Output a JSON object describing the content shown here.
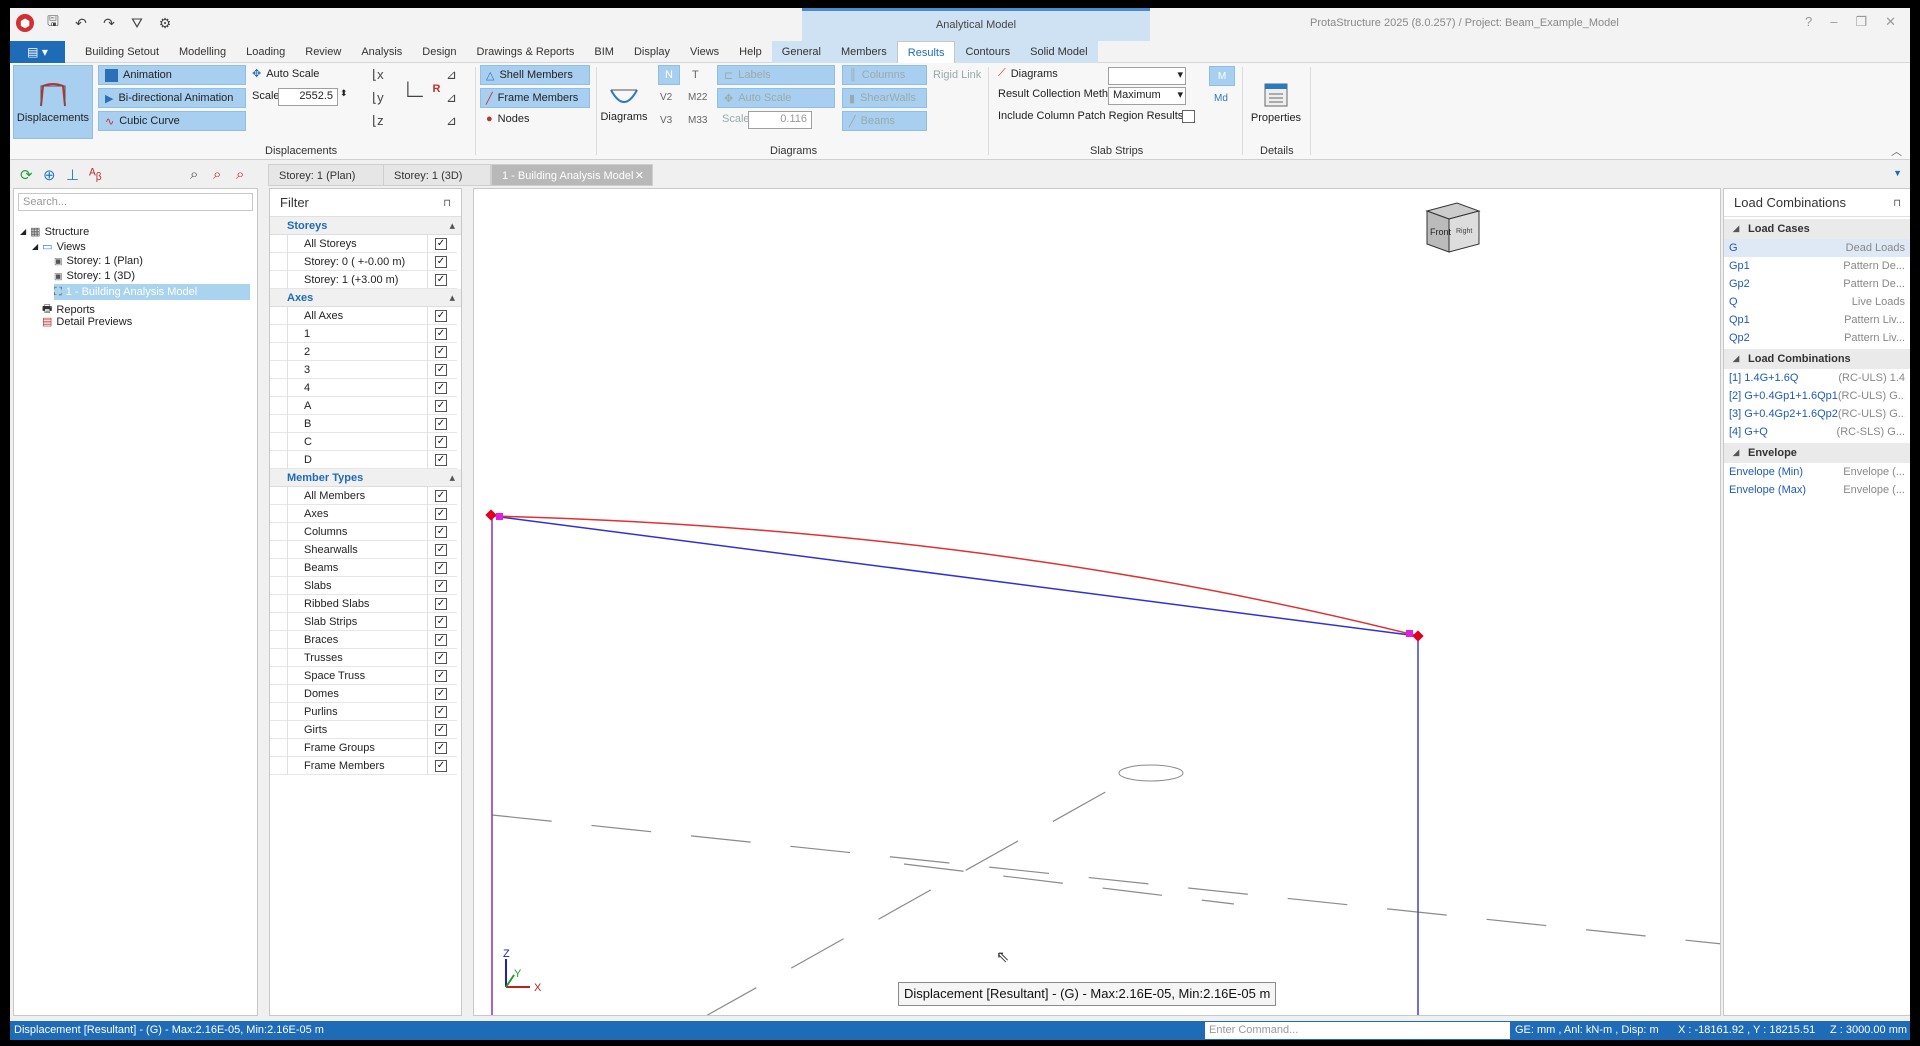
{
  "app": {
    "title": "ProtaStructure 2025 (8.0.257) / Project: Beam_Example_Model",
    "context_header": "Analytical Model"
  },
  "menu": {
    "tabs": [
      "Building Setout",
      "Modelling",
      "Loading",
      "Review",
      "Analysis",
      "Design",
      "Drawings & Reports",
      "BIM",
      "Display",
      "Views",
      "Help"
    ],
    "context_tabs": [
      "General",
      "Members",
      "Results",
      "Contours",
      "Solid Model"
    ],
    "active": "Results"
  },
  "ribbon": {
    "displacements": "Displacements",
    "animation": "Animation",
    "bidir": "Bi-directional Animation",
    "cubic": "Cubic Curve",
    "auto_scale": "Auto Scale",
    "scale_label": "Scale",
    "scale_value": "2552.5",
    "shell_members": "Shell Members",
    "frame_members": "Frame Members",
    "nodes": "Nodes",
    "diagrams": "Diagrams",
    "n": "N",
    "t": "T",
    "v2": "V2",
    "m22": "M22",
    "v3": "V3",
    "m33": "M33",
    "labels": "Labels",
    "auto_scale2": "Auto Scale",
    "scale2_label": "Scale",
    "scale2_value": "0.116",
    "columns": "Columns",
    "shearwalls": "ShearWalls",
    "beams": "Beams",
    "rigid_link": "Rigid Link",
    "ss_diagrams": "Diagrams",
    "rcm_label": "Result Collection Method",
    "rcm_value": "Maximum",
    "include_label": "Include Column Patch Region Results",
    "m": "M",
    "md": "Md",
    "properties": "Properties",
    "groups": {
      "displacements": "Displacements",
      "diagrams": "Diagrams",
      "slab_strips": "Slab Strips",
      "details": "Details"
    }
  },
  "doc_tabs": [
    "Storey: 1 (Plan)",
    "Storey: 1 (3D)",
    "1 - Building Analysis Model"
  ],
  "tree": {
    "search": "Search...",
    "structure": "Structure",
    "views": "Views",
    "v1": "Storey: 1 (Plan)",
    "v2": "Storey: 1 (3D)",
    "v3": "1 - Building Analysis Model",
    "reports": "Reports",
    "previews": "Detail Previews"
  },
  "filter": {
    "title": "Filter",
    "sections": [
      {
        "name": "Storeys",
        "items": [
          "All Storeys",
          "Storey: 0 ( +-0.00 m)",
          "Storey: 1 (+3.00 m)"
        ]
      },
      {
        "name": "Axes",
        "items": [
          "All Axes",
          "1",
          "2",
          "3",
          "4",
          "A",
          "B",
          "C",
          "D"
        ]
      },
      {
        "name": "Member Types",
        "items": [
          "All Members",
          "Axes",
          "Columns",
          "Shearwalls",
          "Beams",
          "Slabs",
          "Ribbed Slabs",
          "Slab Strips",
          "Braces",
          "Trusses",
          "Space Truss",
          "Domes",
          "Purlins",
          "Girts",
          "Frame Groups",
          "Frame Members"
        ]
      }
    ]
  },
  "viewport": {
    "tooltip": "Displacement [Resultant] - (G) -  Max:2.16E-05, Min:2.16E-05 m",
    "cube_front": "Front",
    "cube_right": "Right",
    "axis_z": "Z",
    "axis_y": "Y",
    "axis_x": "X"
  },
  "load_combinations": {
    "title": "Load Combinations",
    "sec_cases": "Load Cases",
    "cases": [
      {
        "id": "G",
        "desc": "Dead Loads"
      },
      {
        "id": "Gp1",
        "desc": "Pattern De..."
      },
      {
        "id": "Gp2",
        "desc": "Pattern De..."
      },
      {
        "id": "Q",
        "desc": "Live Loads"
      },
      {
        "id": "Qp1",
        "desc": "Pattern Liv..."
      },
      {
        "id": "Qp2",
        "desc": "Pattern Liv..."
      }
    ],
    "sec_combos": "Load Combinations",
    "combos": [
      {
        "id": "[1] 1.4G+1.6Q",
        "desc": "(RC-ULS) 1.4"
      },
      {
        "id": "[2] G+0.4Gp1+1.6Qp1",
        "desc": "(RC-ULS) G..."
      },
      {
        "id": "[3] G+0.4Gp2+1.6Qp2",
        "desc": "(RC-ULS) G..."
      },
      {
        "id": "[4] G+Q",
        "desc": "(RC-SLS) G..."
      }
    ],
    "sec_env": "Envelope",
    "envelopes": [
      {
        "id": "Envelope (Min)",
        "desc": "Envelope (..."
      },
      {
        "id": "Envelope (Max)",
        "desc": "Envelope (..."
      }
    ]
  },
  "status": {
    "message": "Displacement [Resultant] - (G) - Max:2.16E-05, Min:2.16E-05 m",
    "command_placeholder": "Enter Command...",
    "units": "GE: mm , Anl: kN-m , Disp: m",
    "coords": "X : -18161.92 , Y : 18215.51",
    "z": "Z : 3000.00 mm"
  }
}
